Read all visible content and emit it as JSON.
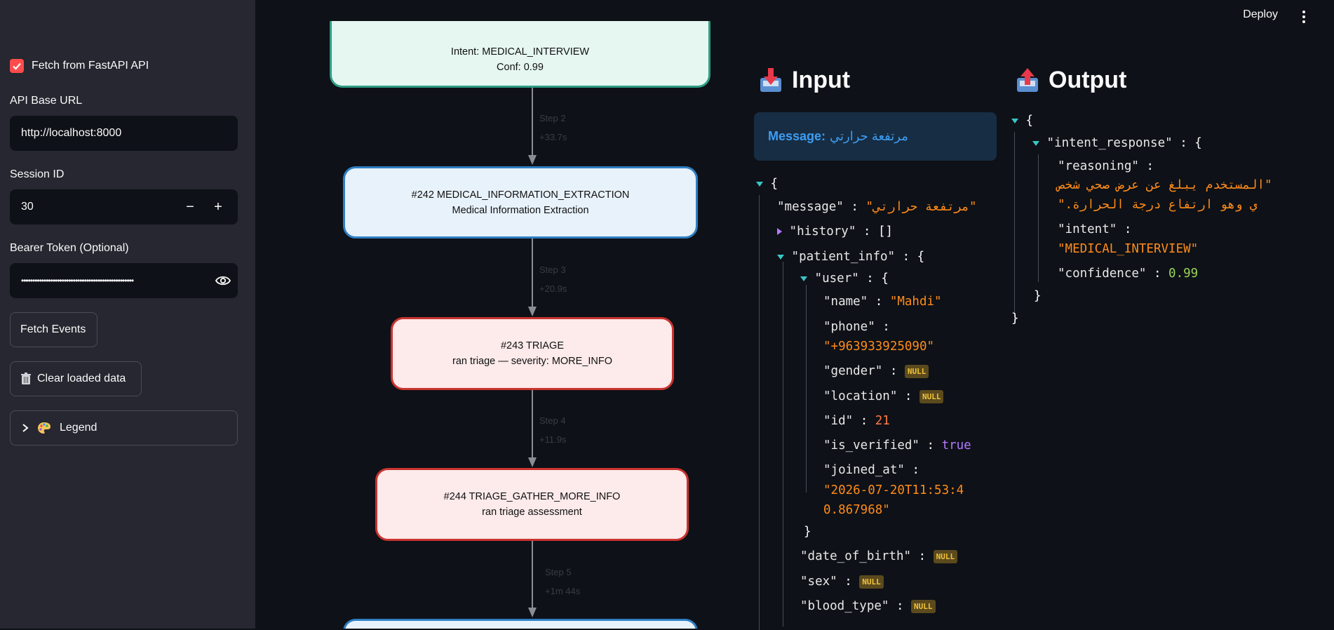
{
  "sidebar": {
    "fetch_checkbox": {
      "label": "Fetch from FastAPI API",
      "checked": true
    },
    "api_base_url": {
      "label": "API Base URL",
      "value": "http://localhost:8000"
    },
    "session_id": {
      "label": "Session ID",
      "value": "30",
      "minus": "−",
      "plus": "+"
    },
    "bearer_token": {
      "label": "Bearer Token (Optional)",
      "value": "••••••••••••••••••••••••••••••••••••••••••••••••••"
    },
    "fetch_button": "Fetch Events",
    "clear_button": {
      "icon": "trash-icon",
      "label": "Clear loaded data"
    },
    "legend": {
      "icon": "palette-icon",
      "label": "Legend"
    }
  },
  "header": {
    "deploy": "Deploy"
  },
  "flow": {
    "nodes": [
      {
        "line1": "Intent: MEDICAL_INTERVIEW",
        "line2": "Conf: 0.99"
      },
      {
        "line1": "#242 MEDICAL_INFORMATION_EXTRACTION",
        "line2": "Medical Information Extraction"
      },
      {
        "line1": "#243 TRIAGE",
        "line2": "ran triage — severity: MORE_INFO"
      },
      {
        "line1": "#244 TRIAGE_GATHER_MORE_INFO",
        "line2": "ran triage assessment"
      }
    ],
    "edges": [
      {
        "step": "Step 2",
        "delta": "+33.7s"
      },
      {
        "step": "Step 3",
        "delta": "+20.9s"
      },
      {
        "step": "Step 4",
        "delta": "+11.9s"
      },
      {
        "step": "Step 5",
        "delta": "+1m 44s"
      }
    ]
  },
  "input": {
    "title": "Input",
    "message_label": "Message:",
    "message_value": "مرتفعة حرارتي",
    "json": {
      "message_key": "\"message\"",
      "message_val": "\"مرتفعة حرارتي\"",
      "history_key": "\"history\"",
      "history_val": "[]",
      "patient_info_key": "\"patient_info\"",
      "user_key": "\"user\"",
      "name_key": "\"name\"",
      "name_val": "\"Mahdi\"",
      "phone_key": "\"phone\"",
      "phone_val": "\"+963933925090\"",
      "gender_key": "\"gender\"",
      "location_key": "\"location\"",
      "id_key": "\"id\"",
      "id_val": "21",
      "is_verified_key": "\"is_verified\"",
      "is_verified_val": "true",
      "joined_at_key": "\"joined_at\"",
      "joined_at_val_1": "\"2026-07-20T11:53:4",
      "joined_at_val_2": "0.867968\"",
      "dob_key": "\"date_of_birth\"",
      "sex_key": "\"sex\"",
      "blood_type_key": "\"blood_type\"",
      "null": "NULL"
    }
  },
  "output": {
    "title": "Output",
    "json": {
      "intent_response_key": "\"intent_response\"",
      "reasoning_key": "\"reasoning\"",
      "reasoning_val_1": "\"المستخدم يبلغ عن عرض صحي شخص",
      "reasoning_val_2": "ي وهو ارتفاع درجة الحرارة.\"",
      "intent_key": "\"intent\"",
      "intent_val": "\"MEDICAL_INTERVIEW\"",
      "confidence_key": "\"confidence\"",
      "confidence_val": "0.99"
    }
  },
  "colors": {
    "accent": "#ff4b4b",
    "node_green_border": "#2f9e86",
    "node_green_fill": "#e6f7f2",
    "node_blue_border": "#2e7fc4",
    "node_blue_fill": "#e8f2fb",
    "node_red_border": "#c9342f",
    "node_red_fill": "#fdeaea"
  }
}
